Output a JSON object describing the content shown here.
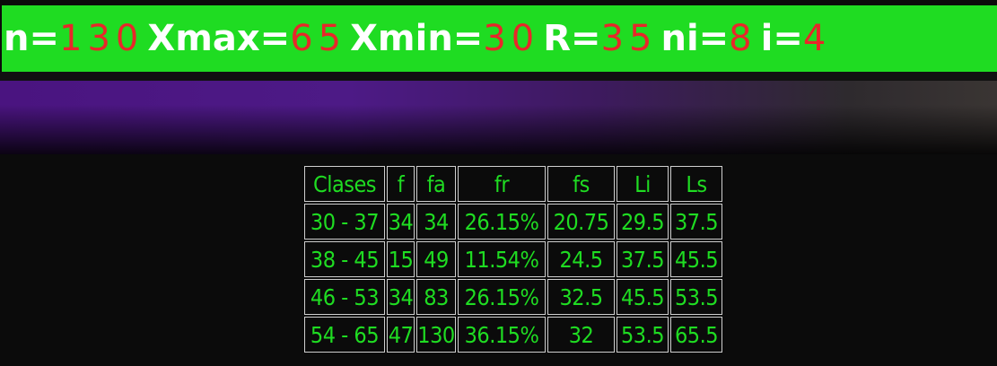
{
  "stats": [
    {
      "label": "n=",
      "value": "130"
    },
    {
      "label": "Xmax=",
      "value": "65"
    },
    {
      "label": "Xmin=",
      "value": "30"
    },
    {
      "label": "R=",
      "value": "35"
    },
    {
      "label": "ni=",
      "value": "8"
    },
    {
      "label": "i=",
      "value": "4"
    }
  ],
  "table": {
    "headers": [
      "Clases",
      "f",
      "fa",
      "fr",
      "fs",
      "Li",
      "Ls"
    ],
    "rows": [
      [
        "30 - 37",
        "34",
        "34",
        "26.15%",
        "20.75",
        "29.5",
        "37.5"
      ],
      [
        "38 - 45",
        "15",
        "49",
        "11.54%",
        "24.5",
        "37.5",
        "45.5"
      ],
      [
        "46 - 53",
        "34",
        "83",
        "26.15%",
        "32.5",
        "45.5",
        "53.5"
      ],
      [
        "54 - 65",
        "47",
        "130",
        "36.15%",
        "32",
        "53.5",
        "65.5"
      ]
    ]
  },
  "colors": {
    "bar_bg": "#1fdc22",
    "label": "#ffffff",
    "value": "#e8272a",
    "table_text": "#1fdc22",
    "table_border": "#cfcfcf",
    "background": "#0b0b0b"
  }
}
